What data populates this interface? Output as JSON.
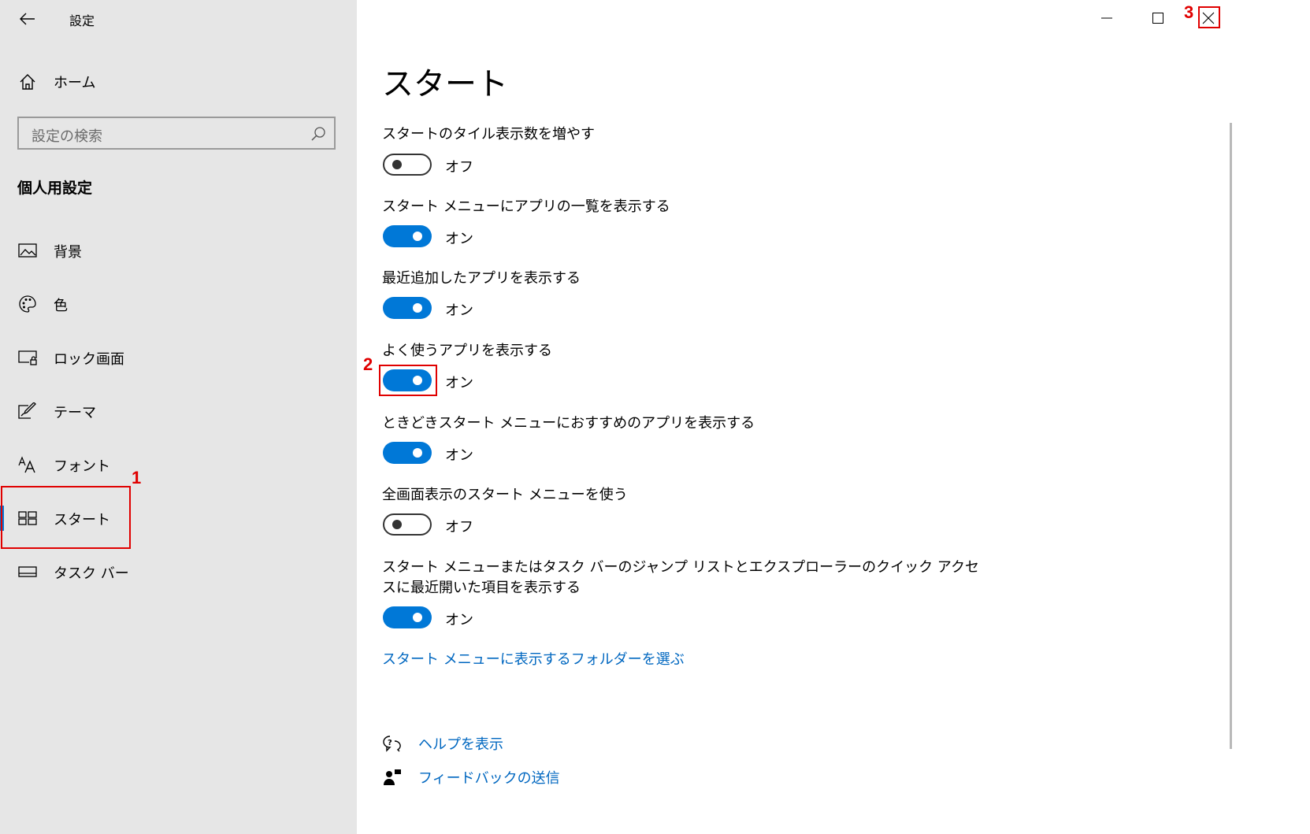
{
  "window": {
    "title": "設定",
    "controls": {
      "minimize_icon": "minimize-icon",
      "maximize_icon": "maximize-icon",
      "close_icon": "close-icon"
    }
  },
  "sidebar": {
    "home_label": "ホーム",
    "search": {
      "placeholder": "設定の検索"
    },
    "section_title": "個人用設定",
    "items": [
      {
        "label": "背景",
        "icon": "picture-icon",
        "active": false
      },
      {
        "label": "色",
        "icon": "palette-icon",
        "active": false
      },
      {
        "label": "ロック画面",
        "icon": "lock-screen-icon",
        "active": false
      },
      {
        "label": "テーマ",
        "icon": "theme-brush-icon",
        "active": false
      },
      {
        "label": "フォント",
        "icon": "font-icon",
        "active": false
      },
      {
        "label": "スタート",
        "icon": "start-tiles-icon",
        "active": true
      },
      {
        "label": "タスク バー",
        "icon": "taskbar-icon",
        "active": false
      }
    ]
  },
  "main": {
    "title": "スタート",
    "settings": [
      {
        "label": "スタートのタイル表示数を増やす",
        "state": "オフ",
        "on": false
      },
      {
        "label": "スタート メニューにアプリの一覧を表示する",
        "state": "オン",
        "on": true
      },
      {
        "label": "最近追加したアプリを表示する",
        "state": "オン",
        "on": true
      },
      {
        "label": "よく使うアプリを表示する",
        "state": "オン",
        "on": true
      },
      {
        "label": "ときどきスタート メニューにおすすめのアプリを表示する",
        "state": "オン",
        "on": true
      },
      {
        "label": "全画面表示のスタート メニューを使う",
        "state": "オフ",
        "on": false
      },
      {
        "label_line1": "スタート メニューまたはタスク バーのジャンプ リストとエクスプローラーのクイック アクセ",
        "label_line2": "スに最近開いた項目を表示する",
        "state": "オン",
        "on": true
      }
    ],
    "folder_link": "スタート メニューに表示するフォルダーを選ぶ",
    "help_link": "ヘルプを表示",
    "feedback_link": "フィードバックの送信"
  },
  "annotations": {
    "step1": "1",
    "step2": "2",
    "step3": "3",
    "color": "#e00000"
  },
  "colors": {
    "accent": "#0078d7",
    "link": "#0067c0",
    "sidebar_bg": "#e6e6e6"
  }
}
